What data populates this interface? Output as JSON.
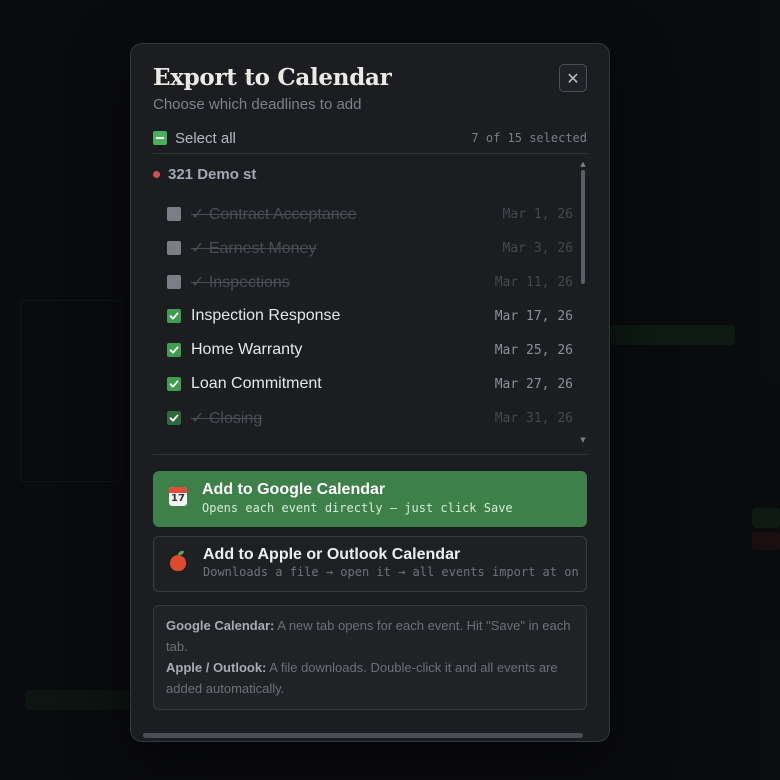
{
  "modal": {
    "title": "Export to Calendar",
    "subtitle": "Choose which deadlines to add",
    "close_glyph": "✕"
  },
  "select_all": {
    "label": "Select all",
    "count_text": "7 of 15 selected",
    "state": "indeterminate"
  },
  "group": {
    "name": "321 Demo st",
    "status_color": "#d05050"
  },
  "items": [
    {
      "label": "✓ Contract Acceptance",
      "date": "Mar 1, 26",
      "checked": false,
      "completed": true
    },
    {
      "label": "✓ Earnest Money",
      "date": "Mar 3, 26",
      "checked": false,
      "completed": true
    },
    {
      "label": "✓ Inspections",
      "date": "Mar 11, 26",
      "checked": false,
      "completed": true
    },
    {
      "label": "Inspection Response",
      "date": "Mar 17, 26",
      "checked": true,
      "completed": false
    },
    {
      "label": "Home Warranty",
      "date": "Mar 25, 26",
      "checked": true,
      "completed": false
    },
    {
      "label": "Loan Commitment",
      "date": "Mar 27, 26",
      "checked": true,
      "completed": false
    },
    {
      "label": "✓ Closing",
      "date": "Mar 31, 26",
      "checked": true,
      "completed": true
    }
  ],
  "google_button": {
    "icon": "calendar-icon",
    "icon_number": "17",
    "title": "Add to Google Calendar",
    "subtitle": "Opens each event directly — just click Save"
  },
  "apple_button": {
    "icon": "apple-icon",
    "title": "Add to Apple or Outlook Calendar",
    "subtitle": "Downloads a file → open it → all events import at on"
  },
  "info": {
    "google_label": "Google Calendar:",
    "google_text": " A new tab opens for each event. Hit \"Save\" in each tab.",
    "apple_label": "Apple / Outlook:",
    "apple_text": " A file downloads. Double-click it and all events are added automatically."
  },
  "colors": {
    "accent_green": "#3e8049",
    "checkbox_green": "#3f9d51",
    "modal_bg": "#1b1d21"
  }
}
